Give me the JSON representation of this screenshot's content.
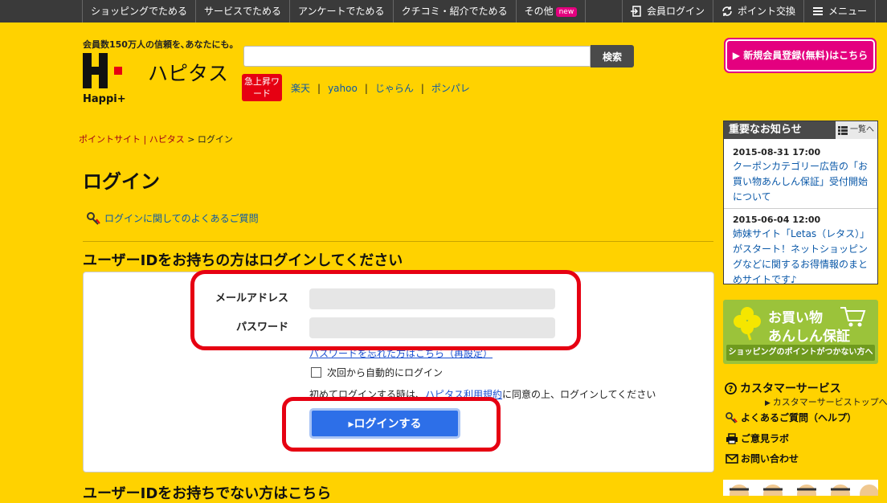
{
  "topnav": {
    "items": [
      "ショッピングでためる",
      "サービスでためる",
      "アンケートでためる",
      "クチコミ・紹介でためる",
      "その他"
    ],
    "new_badge": "new",
    "right": [
      "会員ログイン",
      "ポイント交換",
      "メニュー"
    ]
  },
  "header": {
    "tagline": "会員数150万人の信頼を､あなたにも。",
    "logo_word": "Happi+",
    "brand": "ハピタス",
    "search_placeholder": "",
    "search_button": "検索",
    "hot_label": "急上昇ワード",
    "hot_words": [
      "楽天",
      "yahoo",
      "じゃらん",
      "ポンパレ"
    ],
    "register_button": "▶ 新規会員登録(無料)はこちら"
  },
  "breadcrumb": {
    "home": "ポイントサイト | ハピタス",
    "sep": ">",
    "current": "ログイン"
  },
  "main": {
    "title": "ログイン",
    "faq_link": "ログインに関してのよくあるご質問",
    "section_title": "ユーザーIDをお持ちの方はログインしてください",
    "email_label": "メールアドレス",
    "email_value": "",
    "password_label": "パスワード",
    "password_value": "",
    "forgot_link": "パスワードを忘れた方はこちら（再設定）",
    "remember_label": "次回から自動的にログイン",
    "terms_prefix": "初めてログインする時は、",
    "terms_link": "ハピタス利用規約",
    "terms_suffix": "に同意の上、ログインしてください",
    "login_button": "▸ログインする",
    "section2_title": "ユーザーIDをお持ちでない方はこちら"
  },
  "sidebar": {
    "notice_title": "重要なお知らせ",
    "notice_all": "一覧へ",
    "notices": [
      {
        "date": "2015-08-31 17:00",
        "text": "クーポンカテゴリー広告の「お買い物あんしん保証」受付開始について"
      },
      {
        "date": "2015-06-04 12:00",
        "text": "姉妹サイト「Letas（レタス）」がスタート！ネットショッピングなどに関するお得情報のまとめサイトです♪"
      }
    ],
    "banner_line1": "お買い物",
    "banner_line2": "あんしん保証",
    "banner_sub": "ショッピングのポイントがつかない方へ",
    "cs_title": "カスタマーサービス",
    "cs_top": "カスタマーサービストップへ",
    "cs_links": [
      "よくあるご質問（ヘルプ）",
      "ご意見ラボ",
      "お問い合わせ"
    ]
  },
  "colors": {
    "background": "#ffd200",
    "topbar": "#3a3a3a",
    "accent_pink": "#e4007f",
    "highlight_red": "#e60012",
    "login_blue": "#2d6fe8"
  }
}
